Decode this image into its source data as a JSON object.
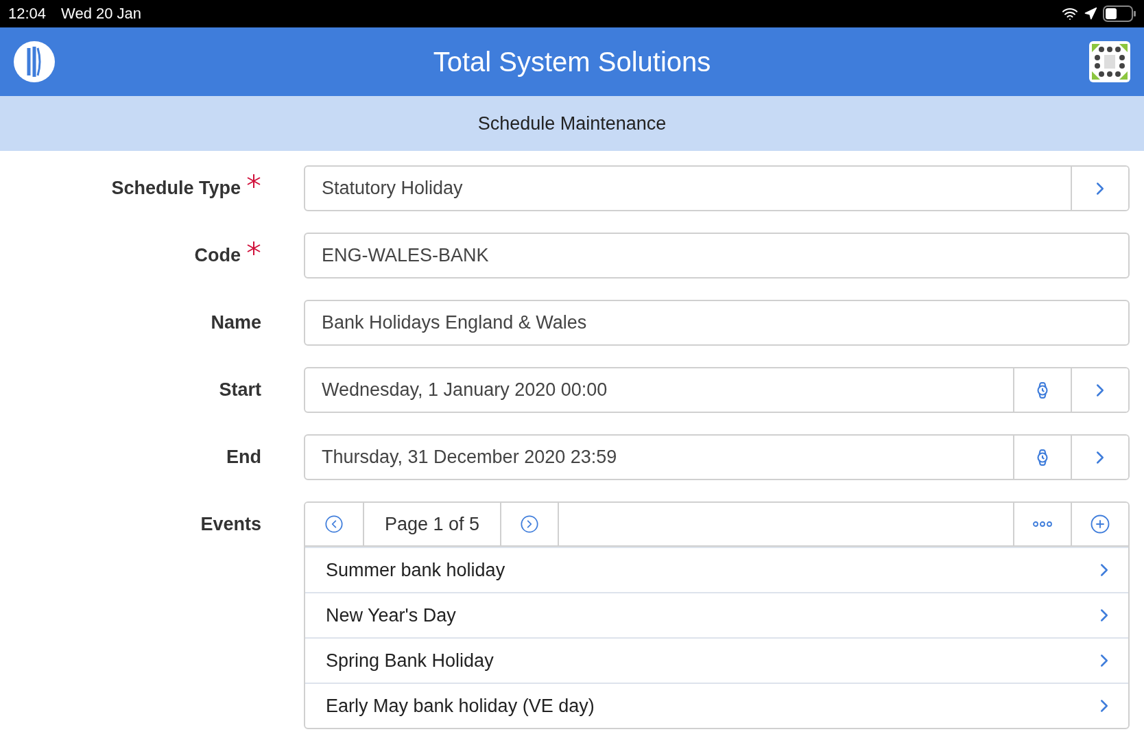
{
  "status_bar": {
    "time": "12:04",
    "date": "Wed 20 Jan"
  },
  "header": {
    "title": "Total System Solutions"
  },
  "subheader": {
    "title": "Schedule Maintenance"
  },
  "fields": [
    {
      "label": "Schedule Type",
      "required": true,
      "kind": "select",
      "value": "Statutory Holiday"
    },
    {
      "label": "Code",
      "required": true,
      "kind": "text",
      "value": "ENG-WALES-BANK"
    },
    {
      "label": "Name",
      "required": false,
      "kind": "text",
      "value": "Bank Holidays England & Wales"
    },
    {
      "label": "Start",
      "required": false,
      "kind": "datetime",
      "value": "Wednesday, 1 January 2020 00:00"
    },
    {
      "label": "End",
      "required": false,
      "kind": "datetime",
      "value": "Thursday, 31 December 2020 23:59"
    }
  ],
  "events": {
    "label": "Events",
    "page": "Page 1 of 5",
    "items": [
      "Summer bank holiday",
      "New Year's Day",
      "Spring Bank Holiday",
      "Early May bank holiday (VE day)"
    ]
  }
}
